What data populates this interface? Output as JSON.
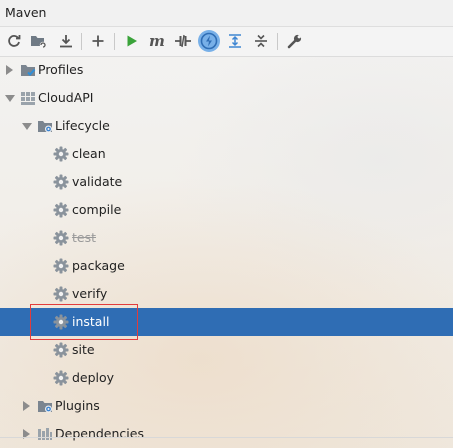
{
  "window": {
    "title": "Maven"
  },
  "toolbar": {
    "buttons": [
      {
        "icon": "reload-icon"
      },
      {
        "icon": "generate-sources-icon"
      },
      {
        "icon": "download-icon"
      },
      {
        "icon": "add-icon"
      },
      {
        "icon": "run-icon"
      },
      {
        "icon": "maven-goal-icon"
      },
      {
        "icon": "toggle-offline-icon"
      },
      {
        "icon": "skip-tests-icon",
        "active": true
      },
      {
        "icon": "show-dependencies-icon"
      },
      {
        "icon": "collapse-all-icon"
      },
      {
        "icon": "settings-wrench-icon"
      }
    ]
  },
  "tree": {
    "profiles": "Profiles",
    "project": "CloudAPI",
    "lifecycle": "Lifecycle",
    "goals": [
      "clean",
      "validate",
      "compile",
      "test",
      "package",
      "verify",
      "install",
      "site",
      "deploy"
    ],
    "goal_test_skipped": "test",
    "selected_goal": "install",
    "plugins": "Plugins",
    "dependencies": "Dependencies"
  },
  "colors": {
    "selection": "#2f6db4",
    "run_green": "#3aa33a",
    "active_toggle": "#78b0e8",
    "highlight_border": "#e23c3c"
  }
}
